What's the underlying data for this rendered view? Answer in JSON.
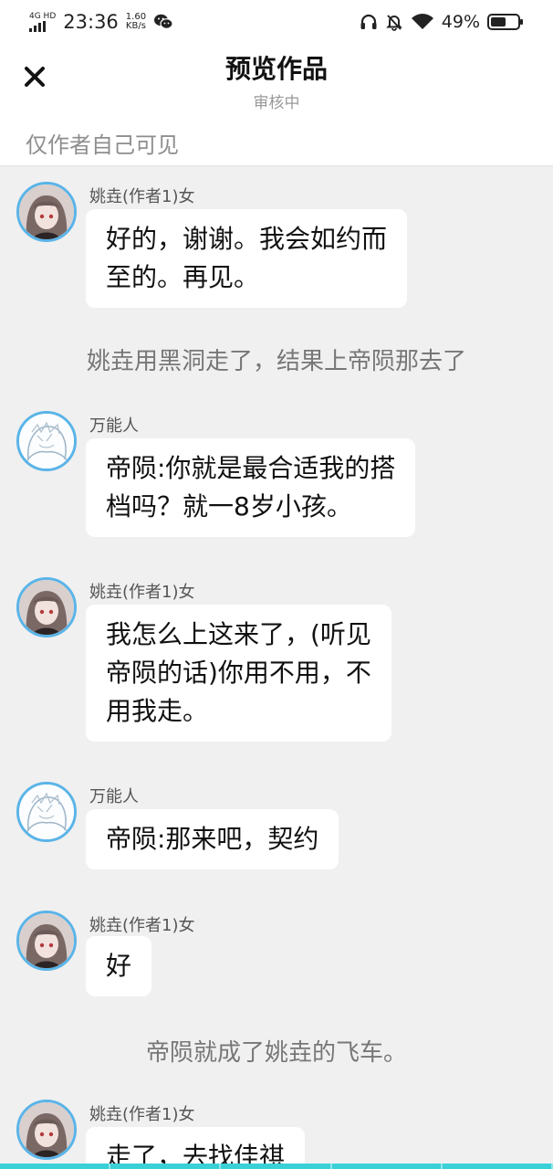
{
  "status_bar": {
    "network": "4G HD",
    "time": "23:36",
    "speed_value": "1.60",
    "speed_unit": "KB/s",
    "battery": "49%"
  },
  "header": {
    "title": "预览作品",
    "subtitle": "审核中",
    "visibility": "仅作者自己可见"
  },
  "messages": [
    {
      "type": "msg",
      "name": "姚垚(作者1)女",
      "avatar": "girl-avatar",
      "lines": [
        "好的，谢谢。我会如约而",
        "至的。再见。"
      ]
    },
    {
      "type": "narration",
      "text": "姚垚用黑洞走了，结果上帝陨那去了"
    },
    {
      "type": "msg",
      "name": "万能人",
      "avatar": "sketch-avatar",
      "lines": [
        "帝陨:你就是最合适我的搭",
        "档吗？就一8岁小孩。"
      ]
    },
    {
      "type": "msg",
      "name": "姚垚(作者1)女",
      "avatar": "girl-avatar",
      "lines": [
        "我怎么上这来了，(听见",
        "帝陨的话)你用不用，不",
        "用我走。"
      ]
    },
    {
      "type": "msg",
      "name": "万能人",
      "avatar": "sketch-avatar",
      "lines": [
        "帝陨:那来吧，契约"
      ]
    },
    {
      "type": "msg",
      "name": "姚垚(作者1)女",
      "avatar": "girl-avatar",
      "lines": [
        "好"
      ]
    },
    {
      "type": "narration",
      "text": "帝陨就成了姚垚的飞车。"
    },
    {
      "type": "msg",
      "name": "姚垚(作者1)女",
      "avatar": "girl-avatar",
      "lines": [
        "走了，去找佳祺"
      ]
    }
  ]
}
